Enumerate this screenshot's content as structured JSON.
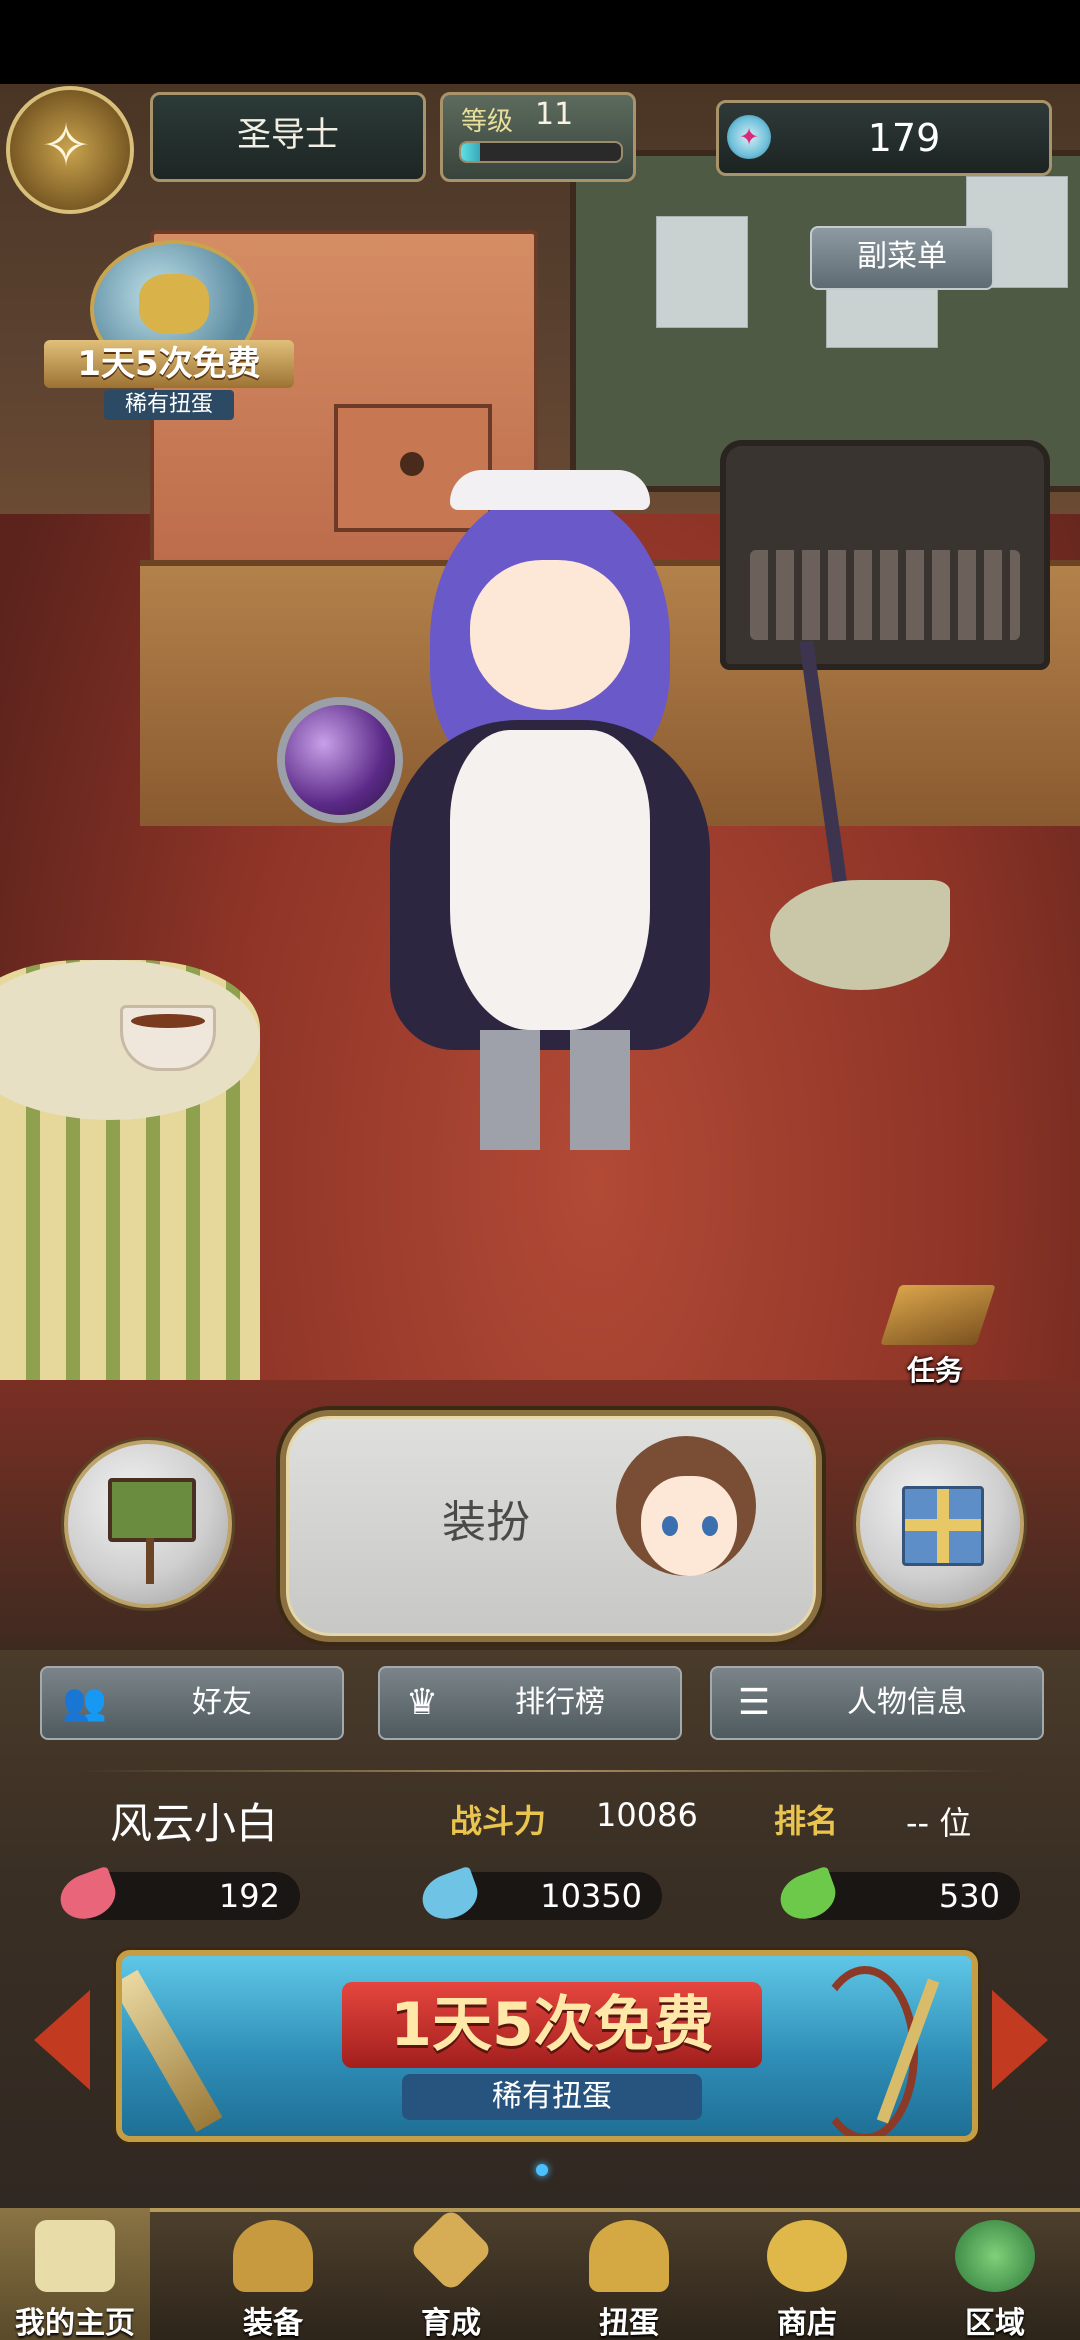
{
  "header": {
    "class_name": "圣导士",
    "level_label": "等级",
    "level_value": "11",
    "xp_fraction": 0.12,
    "gems": "179",
    "submenu_label": "副菜单"
  },
  "gacha_badge": {
    "line1": "1天5次免费",
    "line2": "稀有扭蛋"
  },
  "mission": {
    "label": "任务"
  },
  "dress_up": {
    "label": "装扮"
  },
  "actions": [
    {
      "label": "好友",
      "icon": "friends-icon"
    },
    {
      "label": "排行榜",
      "icon": "crown-icon"
    },
    {
      "label": "人物信息",
      "icon": "profile-list-icon"
    }
  ],
  "player": {
    "name": "风云小白",
    "power_label": "战斗力",
    "power_value": "10086",
    "rank_label": "排名",
    "rank_value": "-- 位"
  },
  "resources": [
    {
      "value": "192",
      "color": "#e8657a"
    },
    {
      "value": "10350",
      "color": "#6fc3e4"
    },
    {
      "value": "530",
      "color": "#6cc94a"
    }
  ],
  "banner": {
    "title": "1天5次免费",
    "subtitle": "稀有扭蛋"
  },
  "nav": [
    {
      "label": "我的主页",
      "icon": "scroll-icon",
      "active": true
    },
    {
      "label": "装备",
      "icon": "helmet-icon",
      "active": false
    },
    {
      "label": "育成",
      "icon": "swords-icon",
      "active": false
    },
    {
      "label": "扭蛋",
      "icon": "gacha-machine-icon",
      "active": false
    },
    {
      "label": "商店",
      "icon": "gold-coins-icon",
      "active": false
    },
    {
      "label": "区域",
      "icon": "globe-icon",
      "active": false
    }
  ]
}
